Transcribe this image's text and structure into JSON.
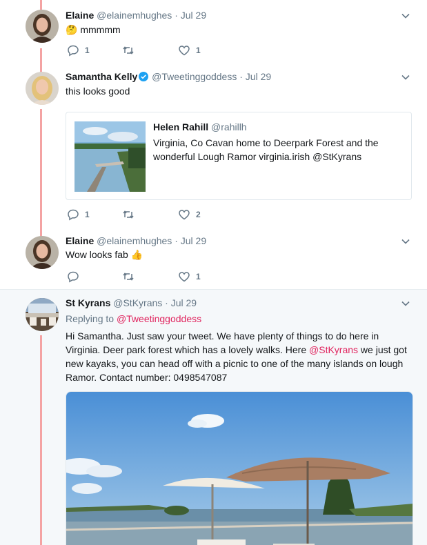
{
  "tweets": [
    {
      "name": "Elaine",
      "handle": "@elainemhughes",
      "separator": "·",
      "date": "Jul 29",
      "emoji": "🤔",
      "text": "mmmmm",
      "reply_count": "1",
      "retweet_count": "",
      "like_count": "1"
    },
    {
      "name": "Samantha Kelly",
      "handle": "@Tweetinggoddess",
      "separator": "·",
      "date": "Jul 29",
      "text": "this looks good",
      "reply_count": "1",
      "retweet_count": "",
      "like_count": "2",
      "quoted": {
        "name": "Helen Rahill",
        "handle": "@rahillh",
        "text": "Virginia, Co Cavan home to Deerpark Forest and the wonderful Lough Ramor virginia.irish @StKyrans"
      }
    },
    {
      "name": "Elaine",
      "handle": "@elainemhughes",
      "separator": "·",
      "date": "Jul 29",
      "text": "Wow looks fab",
      "emoji": "👍",
      "reply_count": "",
      "retweet_count": "",
      "like_count": "1"
    },
    {
      "name": "St Kyrans",
      "handle": "@StKyrans",
      "separator": "·",
      "date": "Jul 29",
      "replying_prefix": "Replying to ",
      "replying_handle": "@Tweetinggoddess",
      "text_1": "Hi Samantha. Just saw your tweet. We have plenty of things to do here in Virginia. Deer park forest which has a lovely walks. Here ",
      "mention": "@StKyrans",
      "text_2": " we just got new kayaks,  you can head off with a picnic to one of the many islands on lough Ramor. Contact number: 0498547087"
    }
  ],
  "colors": {
    "thread_line": "#f4a3a3",
    "link": "#e0245e",
    "verified": "#1da1f2",
    "muted": "#657786"
  },
  "icons": [
    "reply-icon",
    "retweet-icon",
    "like-icon",
    "chevron-down-icon",
    "verified-badge-icon"
  ]
}
